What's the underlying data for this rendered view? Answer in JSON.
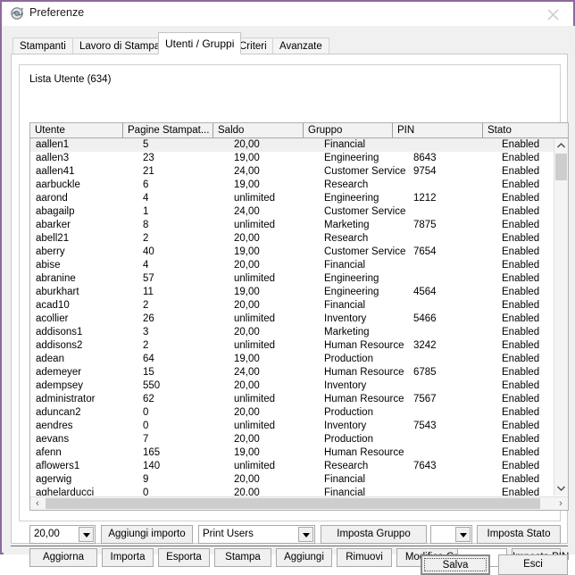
{
  "window": {
    "title": "Preferenze",
    "icon": "app-icon",
    "close_label": "✕",
    "border_color": "#8d6a9c"
  },
  "tabs": [
    {
      "label": "Stampanti",
      "selected": false
    },
    {
      "label": "Lavoro di Stampa",
      "selected": false
    },
    {
      "label": "Utenti / Gruppi",
      "selected": true
    },
    {
      "label": "Criteri",
      "selected": false
    },
    {
      "label": "Avanzate",
      "selected": false
    }
  ],
  "groupbox": {
    "label": "Lista Utente (634)",
    "count": 634
  },
  "table": {
    "columns": [
      "Utente",
      "Pagine Stampat...",
      "Saldo",
      "Gruppo",
      "PIN",
      "Stato"
    ],
    "rows": [
      {
        "utente": "aallen1",
        "pagine": "5",
        "saldo": "20,00",
        "gruppo": "Financial",
        "pin": "",
        "stato": "Enabled",
        "selected": true
      },
      {
        "utente": "aallen3",
        "pagine": "23",
        "saldo": "19,00",
        "gruppo": "Engineering",
        "pin": "8643",
        "stato": "Enabled",
        "selected": false
      },
      {
        "utente": "aallen41",
        "pagine": "21",
        "saldo": "24,00",
        "gruppo": "Customer Service",
        "pin": "9754",
        "stato": "Enabled",
        "selected": false
      },
      {
        "utente": "aarbuckle",
        "pagine": "6",
        "saldo": "19,00",
        "gruppo": "Research",
        "pin": "",
        "stato": "Enabled",
        "selected": false
      },
      {
        "utente": "aarond",
        "pagine": "4",
        "saldo": "unlimited",
        "gruppo": "Engineering",
        "pin": "1212",
        "stato": "Enabled",
        "selected": false
      },
      {
        "utente": "abagailp",
        "pagine": "1",
        "saldo": "24,00",
        "gruppo": "Customer Service",
        "pin": "",
        "stato": "Enabled",
        "selected": false
      },
      {
        "utente": "abarker",
        "pagine": "8",
        "saldo": "unlimited",
        "gruppo": "Marketing",
        "pin": "7875",
        "stato": "Enabled",
        "selected": false
      },
      {
        "utente": "abell21",
        "pagine": "2",
        "saldo": "20,00",
        "gruppo": "Research",
        "pin": "",
        "stato": "Enabled",
        "selected": false
      },
      {
        "utente": "aberry",
        "pagine": "40",
        "saldo": "19,00",
        "gruppo": "Customer Service",
        "pin": "7654",
        "stato": "Enabled",
        "selected": false
      },
      {
        "utente": "abise",
        "pagine": "4",
        "saldo": "20,00",
        "gruppo": "Financial",
        "pin": "",
        "stato": "Enabled",
        "selected": false
      },
      {
        "utente": "abranine",
        "pagine": "57",
        "saldo": "unlimited",
        "gruppo": "Engineering",
        "pin": "",
        "stato": "Enabled",
        "selected": false
      },
      {
        "utente": "aburkhart",
        "pagine": "11",
        "saldo": "19,00",
        "gruppo": "Engineering",
        "pin": "4564",
        "stato": "Enabled",
        "selected": false
      },
      {
        "utente": "acad10",
        "pagine": "2",
        "saldo": "20,00",
        "gruppo": "Financial",
        "pin": "",
        "stato": "Enabled",
        "selected": false
      },
      {
        "utente": "acollier",
        "pagine": "26",
        "saldo": "unlimited",
        "gruppo": "Inventory",
        "pin": "5466",
        "stato": "Enabled",
        "selected": false
      },
      {
        "utente": "addisons1",
        "pagine": "3",
        "saldo": "20,00",
        "gruppo": "Marketing",
        "pin": "",
        "stato": "Enabled",
        "selected": false
      },
      {
        "utente": "addisons2",
        "pagine": "2",
        "saldo": "unlimited",
        "gruppo": "Human Resource",
        "pin": "3242",
        "stato": "Enabled",
        "selected": false
      },
      {
        "utente": "adean",
        "pagine": "64",
        "saldo": "19,00",
        "gruppo": "Production",
        "pin": "",
        "stato": "Enabled",
        "selected": false
      },
      {
        "utente": "ademeyer",
        "pagine": "15",
        "saldo": "24,00",
        "gruppo": "Human Resource",
        "pin": "6785",
        "stato": "Enabled",
        "selected": false
      },
      {
        "utente": "adempsey",
        "pagine": "550",
        "saldo": "20,00",
        "gruppo": "Inventory",
        "pin": "",
        "stato": "Enabled",
        "selected": false
      },
      {
        "utente": "administrator",
        "pagine": "62",
        "saldo": "unlimited",
        "gruppo": "Human Resource",
        "pin": "7567",
        "stato": "Enabled",
        "selected": false
      },
      {
        "utente": "aduncan2",
        "pagine": "0",
        "saldo": "20,00",
        "gruppo": "Production",
        "pin": "",
        "stato": "Enabled",
        "selected": false
      },
      {
        "utente": "aendres",
        "pagine": "0",
        "saldo": "unlimited",
        "gruppo": "Inventory",
        "pin": "7543",
        "stato": "Enabled",
        "selected": false
      },
      {
        "utente": "aevans",
        "pagine": "7",
        "saldo": "20,00",
        "gruppo": "Production",
        "pin": "",
        "stato": "Enabled",
        "selected": false
      },
      {
        "utente": "afenn",
        "pagine": "165",
        "saldo": "19,00",
        "gruppo": "Human Resource",
        "pin": "",
        "stato": "Enabled",
        "selected": false
      },
      {
        "utente": "aflowers1",
        "pagine": "140",
        "saldo": "unlimited",
        "gruppo": "Research",
        "pin": "7643",
        "stato": "Enabled",
        "selected": false
      },
      {
        "utente": "agerwig",
        "pagine": "9",
        "saldo": "20,00",
        "gruppo": "Financial",
        "pin": "",
        "stato": "Enabled",
        "selected": false
      },
      {
        "utente": "aghelarducci",
        "pagine": "0",
        "saldo": "20,00",
        "gruppo": "Financial",
        "pin": "",
        "stato": "Enabled",
        "selected": false
      }
    ]
  },
  "controls_row1": {
    "amount_value": "20,00",
    "add_amount_label": "Aggiungi importo",
    "group_value": "Print Users",
    "set_group_label": "Imposta Gruppo",
    "status_value": "",
    "set_status_label": "Imposta Stato"
  },
  "controls_row2": {
    "refresh_label": "Aggiorna",
    "import_label": "Importa",
    "export_label": "Esporta",
    "print_label": "Stampa",
    "add_label": "Aggiungi",
    "remove_label": "Rimuovi",
    "edit_group_label": "Modifica Gruppo",
    "pin_value": "",
    "set_pin_label": "Imposta PIN"
  },
  "footer": {
    "save_label": "Salva",
    "exit_label": "Esci"
  },
  "scroll": {
    "up_arrow": "▲",
    "down_arrow": "▼",
    "left_arrow": "‹",
    "right_arrow": "›"
  }
}
